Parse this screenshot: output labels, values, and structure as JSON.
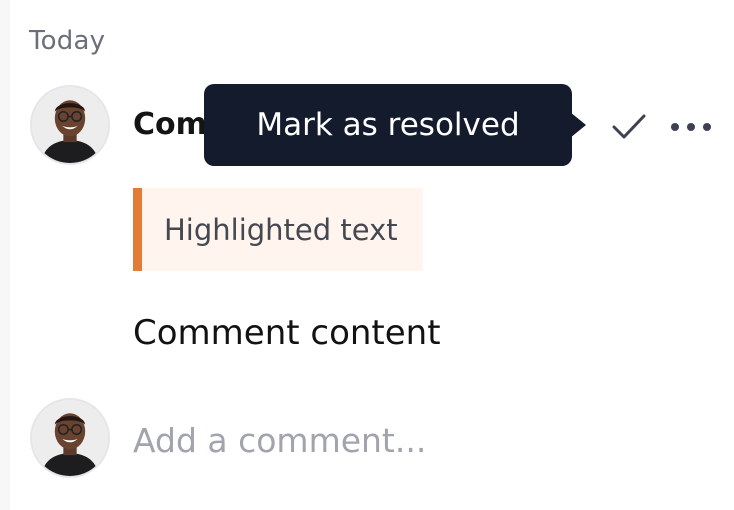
{
  "section": {
    "label": "Today"
  },
  "comment": {
    "author": "Com",
    "highlighted_text": "Highlighted text",
    "content": "Comment content"
  },
  "tooltip": {
    "label": "Mark as resolved"
  },
  "actions": {
    "resolve_icon": "checkmark-icon",
    "more_icon": "more-horizontal-icon"
  },
  "composer": {
    "placeholder": "Add a comment..."
  },
  "colors": {
    "tooltip_bg": "#141b2d",
    "highlight_bg": "#fff5ee",
    "highlight_accent": "#e27b35",
    "muted_text": "#6b6f7a"
  }
}
